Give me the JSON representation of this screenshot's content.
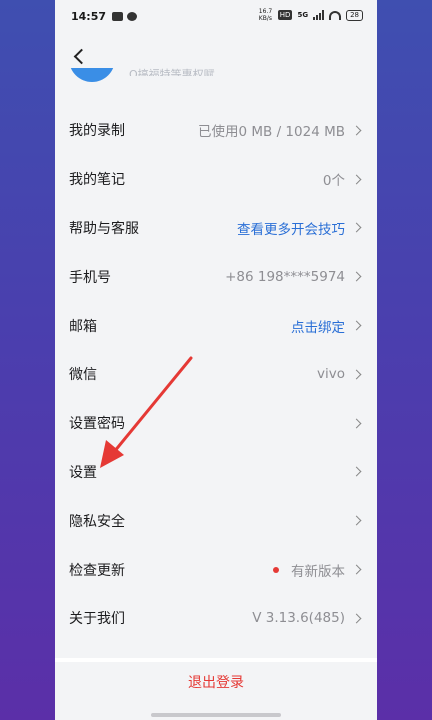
{
  "status_bar": {
    "time": "14:57",
    "hd_badge": "HD",
    "network_5g": "5G",
    "speed": "16.7 KB/s",
    "battery": "28"
  },
  "header": {
    "back_icon": "chevron-left-icon",
    "subtitle_partial": "Q搞福特等惠权赋"
  },
  "settings_list": [
    {
      "label": "我的录制",
      "value": "已使用0 MB / 1024 MB",
      "value_style": "gray"
    },
    {
      "label": "我的笔记",
      "value": "0个",
      "value_style": "gray"
    },
    {
      "label": "帮助与客服",
      "value": "查看更多开会技巧",
      "value_style": "link"
    },
    {
      "label": "手机号",
      "value": "+86 198****5974",
      "value_style": "gray"
    },
    {
      "label": "邮箱",
      "value": "点击绑定",
      "value_style": "link"
    },
    {
      "label": "微信",
      "value": "vivo",
      "value_style": "gray"
    },
    {
      "label": "设置密码",
      "value": "",
      "value_style": "gray"
    },
    {
      "label": "设置",
      "value": "",
      "value_style": "gray"
    },
    {
      "label": "隐私安全",
      "value": "",
      "value_style": "gray"
    },
    {
      "label": "检查更新",
      "value": "有新版本",
      "value_style": "gray",
      "badge": "red-dot"
    },
    {
      "label": "关于我们",
      "value": "V 3.13.6(485)",
      "value_style": "gray"
    }
  ],
  "logout_label": "退出登录",
  "colors": {
    "link": "#2a6fd6",
    "danger": "#e53935",
    "annotation_arrow": "#e53935"
  }
}
